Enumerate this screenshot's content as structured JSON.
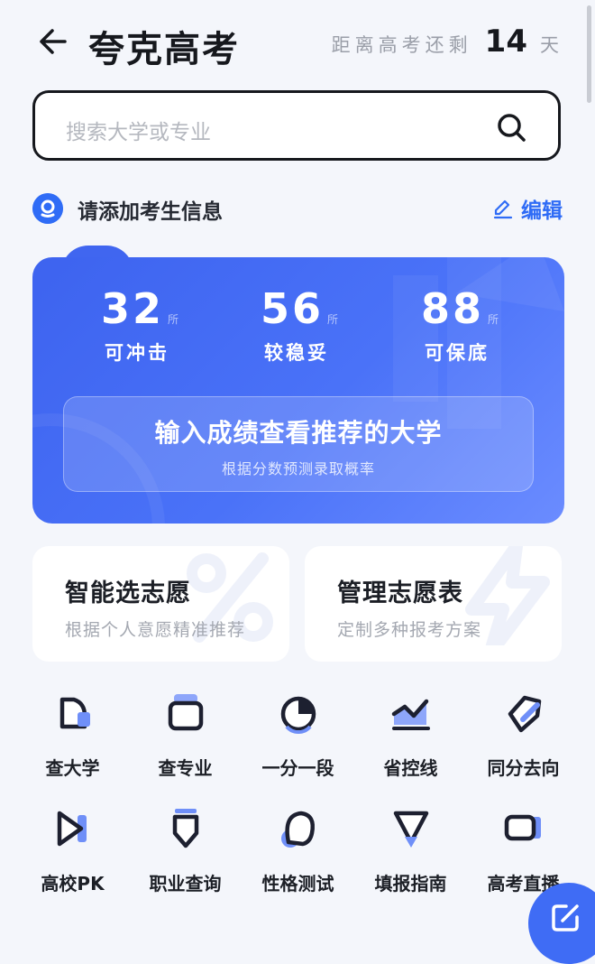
{
  "header": {
    "title": "夸克高考",
    "countdown_prefix": "距离高考还剩",
    "countdown_days": "14",
    "countdown_unit": "天"
  },
  "search": {
    "placeholder": "搜索大学或专业"
  },
  "student": {
    "label": "请添加考生信息",
    "edit_label": "编辑"
  },
  "recommend": {
    "stats": [
      {
        "value": "32",
        "unit": "所",
        "label": "可冲击"
      },
      {
        "value": "56",
        "unit": "所",
        "label": "较稳妥"
      },
      {
        "value": "88",
        "unit": "所",
        "label": "可保底"
      }
    ],
    "cta_title": "输入成绩查看推荐的大学",
    "cta_subtitle": "根据分数预测录取概率"
  },
  "features": [
    {
      "title": "智能选志愿",
      "subtitle": "根据个人意愿精准推荐"
    },
    {
      "title": "管理志愿表",
      "subtitle": "定制多种报考方案"
    }
  ],
  "tools": [
    {
      "label": "查大学",
      "icon": "university-icon"
    },
    {
      "label": "查专业",
      "icon": "major-icon"
    },
    {
      "label": "一分一段",
      "icon": "pie-icon"
    },
    {
      "label": "省控线",
      "icon": "trend-line-icon"
    },
    {
      "label": "同分去向",
      "icon": "tag-icon"
    },
    {
      "label": "高校PK",
      "icon": "pk-icon"
    },
    {
      "label": "职业查询",
      "icon": "career-badge-icon"
    },
    {
      "label": "性格测试",
      "icon": "personality-icon"
    },
    {
      "label": "填报指南",
      "icon": "guide-triangle-icon"
    },
    {
      "label": "高考直播",
      "icon": "live-camera-icon"
    }
  ],
  "colors": {
    "accent": "#2f6cf6",
    "card_start": "#3d63ef",
    "card_end": "#6b8cff"
  }
}
